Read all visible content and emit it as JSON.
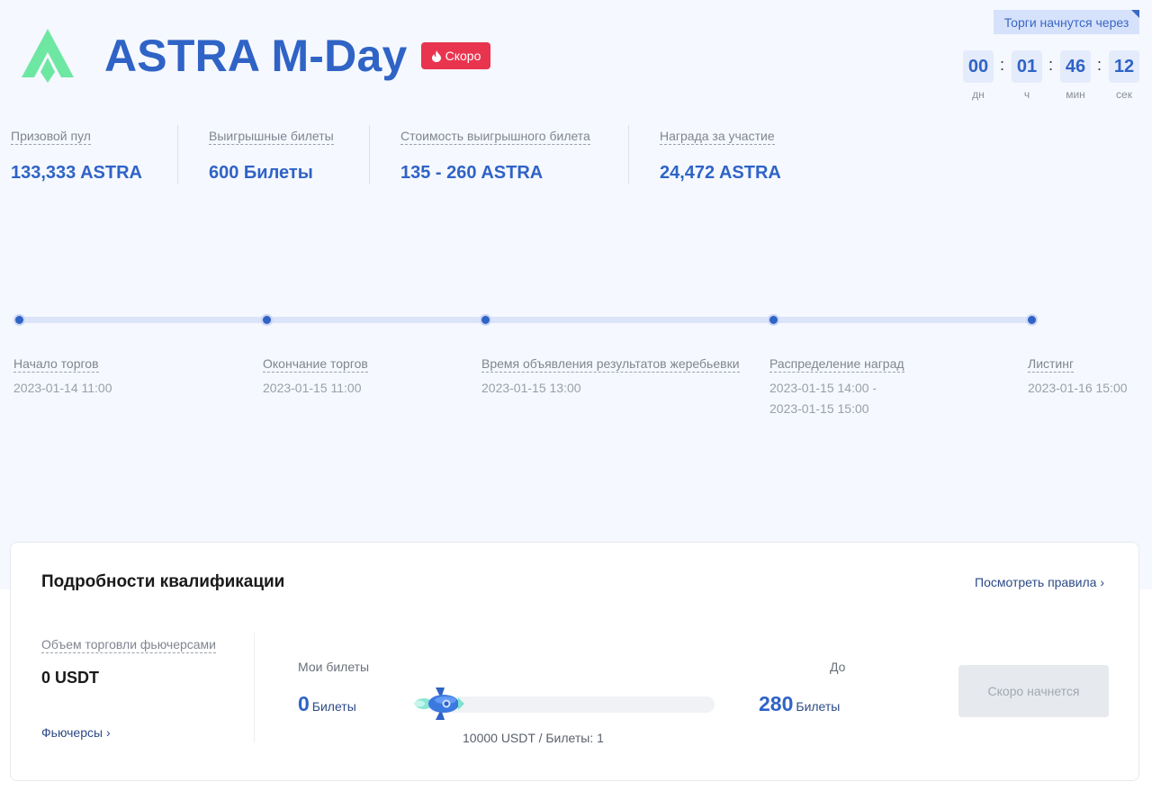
{
  "header": {
    "title": "ASTRA M-Day",
    "badge": "Скоро",
    "logo_color": "#6ee7a2",
    "brand_color": "#2f63c6",
    "badge_color": "#e8344f"
  },
  "countdown": {
    "label": "Торги начнутся через",
    "days": "00",
    "hours": "01",
    "minutes": "46",
    "seconds": "12",
    "units": {
      "days": "дн",
      "hours": "ч",
      "minutes": "мин",
      "seconds": "сек"
    },
    "separator": ":"
  },
  "stats": [
    {
      "label": "Призовой пул",
      "value": "133,333 ASTRA"
    },
    {
      "label": "Выигрышные билеты",
      "value": "600 Билеты"
    },
    {
      "label": "Стоимость выигрышного билета",
      "value": "135 - 260 ASTRA"
    },
    {
      "label": "Награда за участие",
      "value": "24,472 ASTRA"
    }
  ],
  "timeline": [
    {
      "label": "Начало торгов",
      "date": "2023-01-14 11:00"
    },
    {
      "label": "Окончание торгов",
      "date": "2023-01-15 11:00"
    },
    {
      "label": "Время объявления результатов жеребьевки",
      "date": "2023-01-15 13:00"
    },
    {
      "label": "Распределение наград",
      "date": "2023-01-15 14:00 -",
      "date2": "2023-01-15 15:00"
    },
    {
      "label": "Листинг",
      "date": "2023-01-16 15:00"
    }
  ],
  "qualification": {
    "title": "Подробности квалификации",
    "rules_link": "Посмотреть правила",
    "futures_label": "Объем торговли фьючерсами",
    "futures_value": "0 USDT",
    "futures_link": "Фьючерсы",
    "my_tickets_label": "Мои билеты",
    "my_tickets_value": "0",
    "tickets_unit": "Билеты",
    "to_label": "До",
    "max_tickets_value": "280",
    "progress": 0,
    "rate": "10000 USDT / Билеты: 1",
    "button": "Скоро начнется",
    "chevron": "›"
  }
}
